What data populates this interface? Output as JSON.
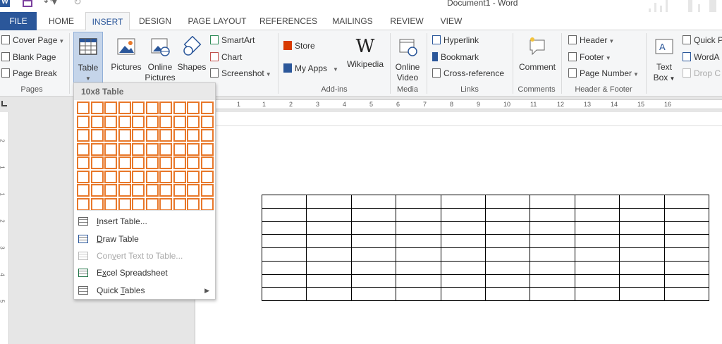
{
  "window": {
    "title": "Document1 - Word"
  },
  "tabs": [
    {
      "label": "FILE"
    },
    {
      "label": "HOME"
    },
    {
      "label": "INSERT"
    },
    {
      "label": "DESIGN"
    },
    {
      "label": "PAGE LAYOUT"
    },
    {
      "label": "REFERENCES"
    },
    {
      "label": "MAILINGS"
    },
    {
      "label": "REVIEW"
    },
    {
      "label": "VIEW"
    }
  ],
  "ribbon": {
    "pages": {
      "label": "Pages",
      "cover_page": "Cover Page",
      "blank_page": "Blank Page",
      "page_break": "Page Break"
    },
    "tables": {
      "table": "Table"
    },
    "illustrations": {
      "pictures": "Pictures",
      "online_pictures_line1": "Online",
      "online_pictures_line2": "Pictures",
      "shapes": "Shapes",
      "smartart": "SmartArt",
      "chart": "Chart",
      "screenshot": "Screenshot"
    },
    "addins": {
      "label": "Add-ins",
      "store": "Store",
      "my_apps": "My Apps",
      "wikipedia": "Wikipedia"
    },
    "media": {
      "label": "Media",
      "online_video_line1": "Online",
      "online_video_line2": "Video"
    },
    "links": {
      "label": "Links",
      "hyperlink": "Hyperlink",
      "bookmark": "Bookmark",
      "cross_reference": "Cross-reference"
    },
    "comments": {
      "label": "Comments",
      "comment": "Comment"
    },
    "header_footer": {
      "label": "Header & Footer",
      "header": "Header",
      "footer": "Footer",
      "page_number": "Page Number"
    },
    "text": {
      "text_box_line1": "Text",
      "text_box_line2": "Box",
      "quick_parts": "Quick P",
      "wordart": "WordA",
      "drop_cap": "Drop C"
    }
  },
  "ruler": {
    "h_numbers": [
      "1",
      "1",
      "2",
      "3",
      "4",
      "5",
      "6",
      "7",
      "8",
      "9",
      "10",
      "11",
      "12",
      "13",
      "14",
      "15",
      "16"
    ],
    "v_numbers": [
      "2",
      "1",
      "1",
      "2",
      "3",
      "4",
      "5"
    ]
  },
  "table_menu": {
    "header": "10x8 Table",
    "grid": {
      "cols": 10,
      "rows": 8,
      "selected_cols": 10,
      "selected_rows": 8
    },
    "items": [
      {
        "label": "Insert Table...",
        "accel": "I",
        "rest": "nsert Table...",
        "enabled": true
      },
      {
        "label": "Draw Table",
        "accel": "D",
        "rest": "raw Table",
        "enabled": true
      },
      {
        "label": "Convert Text to Table...",
        "pre": "Con",
        "accel": "v",
        "rest": "ert Text to Table...",
        "enabled": false
      },
      {
        "label": "Excel Spreadsheet",
        "accel": "x",
        "pre": "E",
        "rest": "cel Spreadsheet",
        "enabled": true
      },
      {
        "label": "Quick Tables",
        "pre": "Quick ",
        "accel": "T",
        "rest": "ables",
        "enabled": true,
        "submenu": true
      }
    ]
  },
  "document": {
    "table": {
      "cols": 10,
      "rows": 8
    }
  },
  "colors": {
    "brand": "#2b579a",
    "grid_highlight": "#e8782a",
    "table_active": "#c5d5ea"
  }
}
